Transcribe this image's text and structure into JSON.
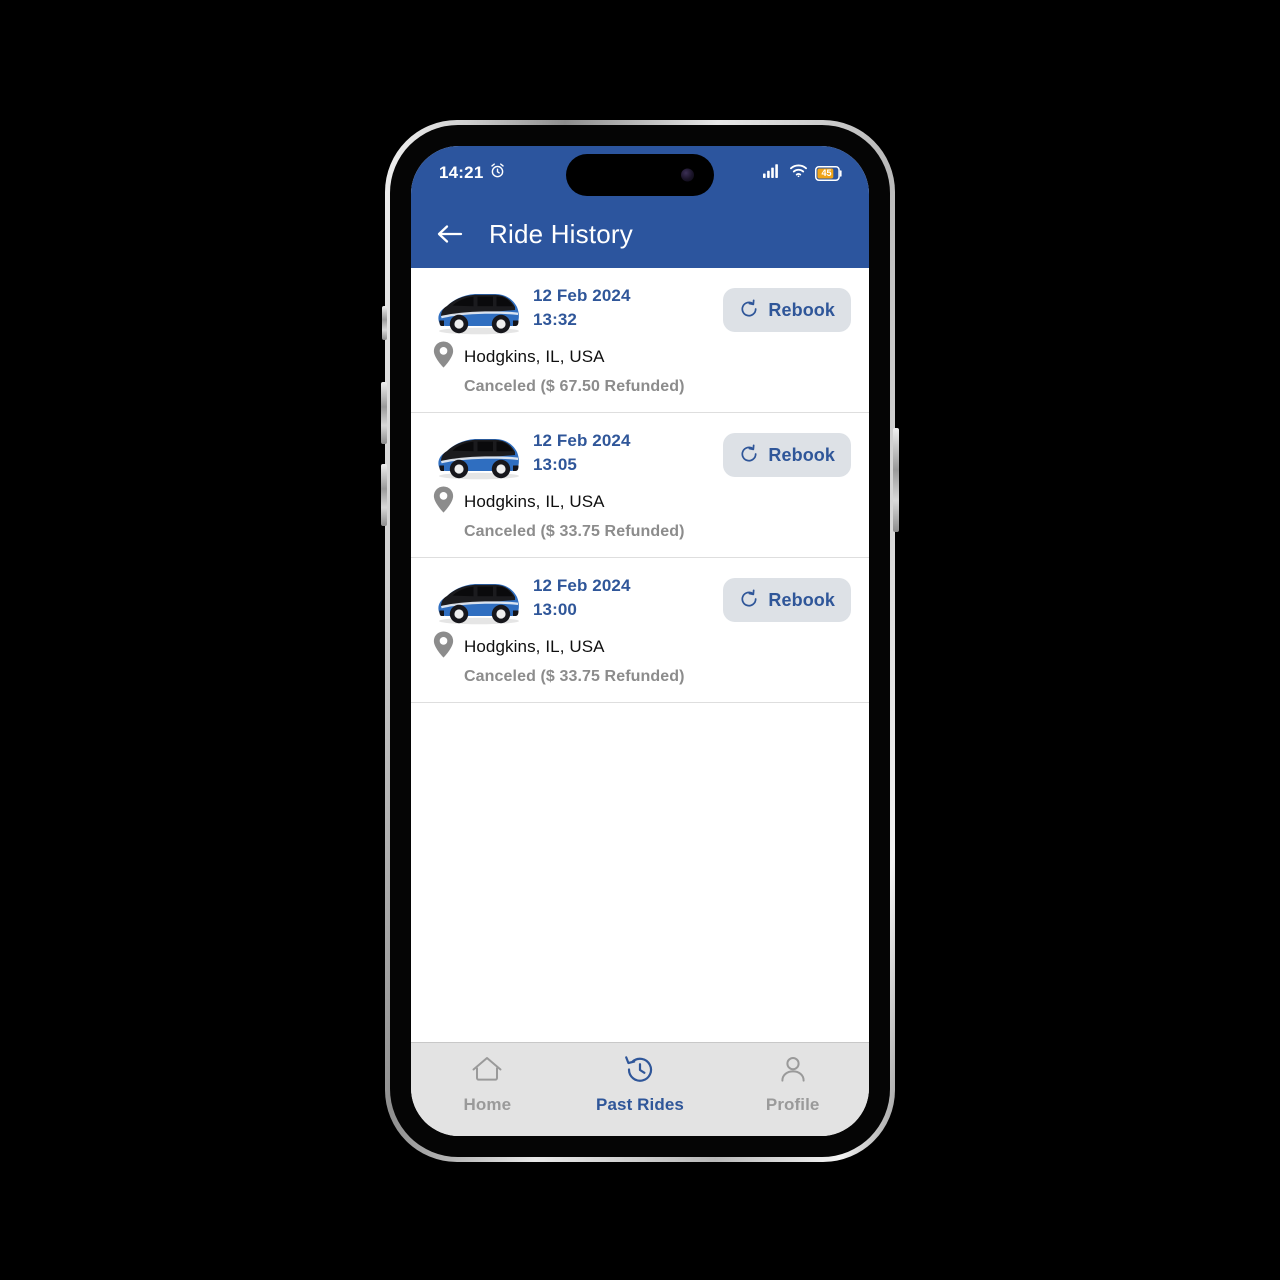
{
  "status_bar": {
    "time": "14:21",
    "alarm_icon": "alarm-clock-icon",
    "signal_icon": "cellular-signal-icon",
    "wifi_icon": "wifi-icon",
    "battery_level": "45",
    "battery_icon": "battery-icon"
  },
  "app_bar": {
    "back_icon": "back-arrow-icon",
    "title": "Ride History"
  },
  "rides": [
    {
      "vehicle_icon": "car-icon",
      "date": "12 Feb 2024",
      "time": "13:32",
      "location_icon": "location-pin-icon",
      "location": "Hodgkins, IL, USA",
      "status": "Canceled ($ 67.50 Refunded)",
      "rebook_icon": "rotate-left-icon",
      "rebook_label": "Rebook"
    },
    {
      "vehicle_icon": "car-icon",
      "date": "12 Feb 2024",
      "time": "13:05",
      "location_icon": "location-pin-icon",
      "location": "Hodgkins, IL, USA",
      "status": "Canceled ($ 33.75 Refunded)",
      "rebook_icon": "rotate-left-icon",
      "rebook_label": "Rebook"
    },
    {
      "vehicle_icon": "car-icon",
      "date": "12 Feb 2024",
      "time": "13:00",
      "location_icon": "location-pin-icon",
      "location": "Hodgkins, IL, USA",
      "status": "Canceled ($ 33.75 Refunded)",
      "rebook_icon": "rotate-left-icon",
      "rebook_label": "Rebook"
    }
  ],
  "bottom_nav": {
    "items": [
      {
        "label": "Home",
        "icon": "home-icon",
        "active": false
      },
      {
        "label": "Past Rides",
        "icon": "ride-history-icon",
        "active": true
      },
      {
        "label": "Profile",
        "icon": "person-icon",
        "active": false
      }
    ]
  },
  "colors": {
    "brand_blue": "#2c559e",
    "accent_text_blue": "#2f5699",
    "muted_gray": "#8c8c8c",
    "nav_bar_bg": "#e3e3e3",
    "rebook_bg": "#dde1e6",
    "battery_fill": "#f0a316"
  }
}
